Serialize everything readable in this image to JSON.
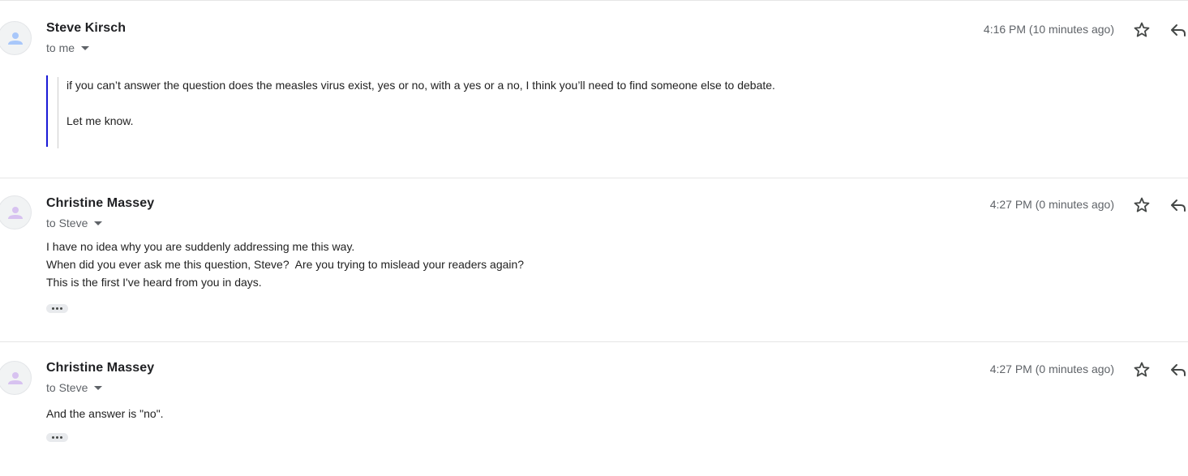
{
  "messages": [
    {
      "sender": "Steve Kirsch",
      "recipient": "to me",
      "time": "4:16 PM (10 minutes ago)",
      "avatar_color": "#a8c7fa",
      "quoted_lines": [
        "if you can’t answer the question does the measles virus exist, yes or no, with a yes or a no, I think you’ll need to find someone else to debate.",
        "Let me know."
      ]
    },
    {
      "sender": "Christine Massey",
      "recipient": "to Steve",
      "time": "4:27 PM (0 minutes ago)",
      "avatar_color": "#d7c2f0",
      "body_lines": [
        "I have no idea why you are suddenly addressing me this way.",
        "When did you ever ask me this question, Steve?  Are you trying to mislead your readers again?",
        "This is the first I've heard from you in days."
      ]
    },
    {
      "sender": "Christine Massey",
      "recipient": "to Steve",
      "time": "4:27 PM (0 minutes ago)",
      "avatar_color": "#d7c2f0",
      "body_lines": [
        "And the answer is \"no\"."
      ]
    }
  ],
  "icons": {
    "star": "star-outline-icon",
    "reply": "reply-arrow-icon",
    "more": "ellipsis-icon",
    "recipient_menu": "caret-down-icon"
  },
  "colors": {
    "quote_bar": "#1a1ad6",
    "text": "#222222",
    "muted": "#5f6368"
  }
}
